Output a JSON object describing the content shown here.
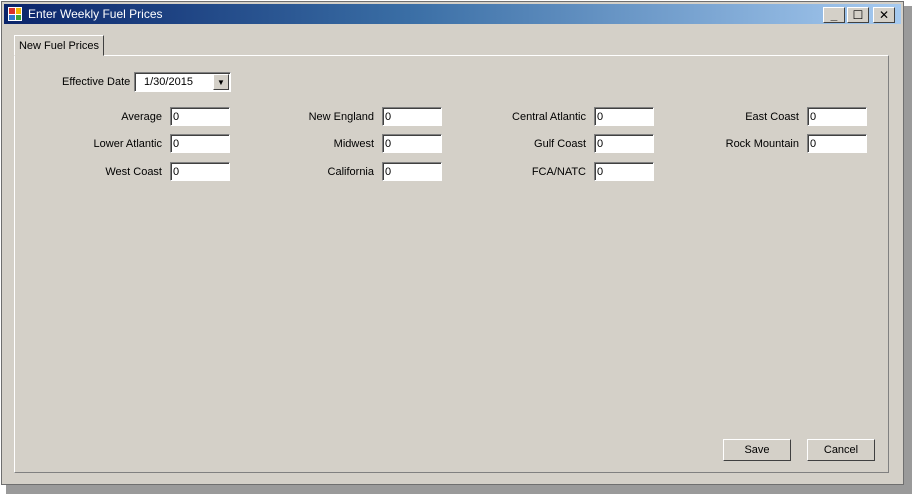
{
  "window": {
    "title": "Enter Weekly Fuel Prices",
    "minimize_glyph": "_",
    "maximize_glyph": "☐",
    "close_glyph": "✕"
  },
  "tabs": [
    {
      "label": "New Fuel Prices",
      "active": true
    }
  ],
  "effective_date": {
    "label": "Effective Date",
    "value": "1/30/2015"
  },
  "fields": {
    "average": {
      "label": "Average",
      "value": "0"
    },
    "new_england": {
      "label": "New England",
      "value": "0"
    },
    "central_atlantic": {
      "label": "Central Atlantic",
      "value": "0"
    },
    "east_coast": {
      "label": "East Coast",
      "value": "0"
    },
    "lower_atlantic": {
      "label": "Lower Atlantic",
      "value": "0"
    },
    "midwest": {
      "label": "Midwest",
      "value": "0"
    },
    "gulf_coast": {
      "label": "Gulf Coast",
      "value": "0"
    },
    "rock_mountain": {
      "label": "Rock Mountain",
      "value": "0"
    },
    "west_coast": {
      "label": "West Coast",
      "value": "0"
    },
    "california": {
      "label": "California",
      "value": "0"
    },
    "fca_natc": {
      "label": "FCA/NATC",
      "value": "0"
    }
  },
  "buttons": {
    "save": "Save",
    "cancel": "Cancel"
  },
  "colors": {
    "title_start": "#0a246a",
    "title_end": "#a6caf0",
    "face": "#d4d0c8"
  }
}
